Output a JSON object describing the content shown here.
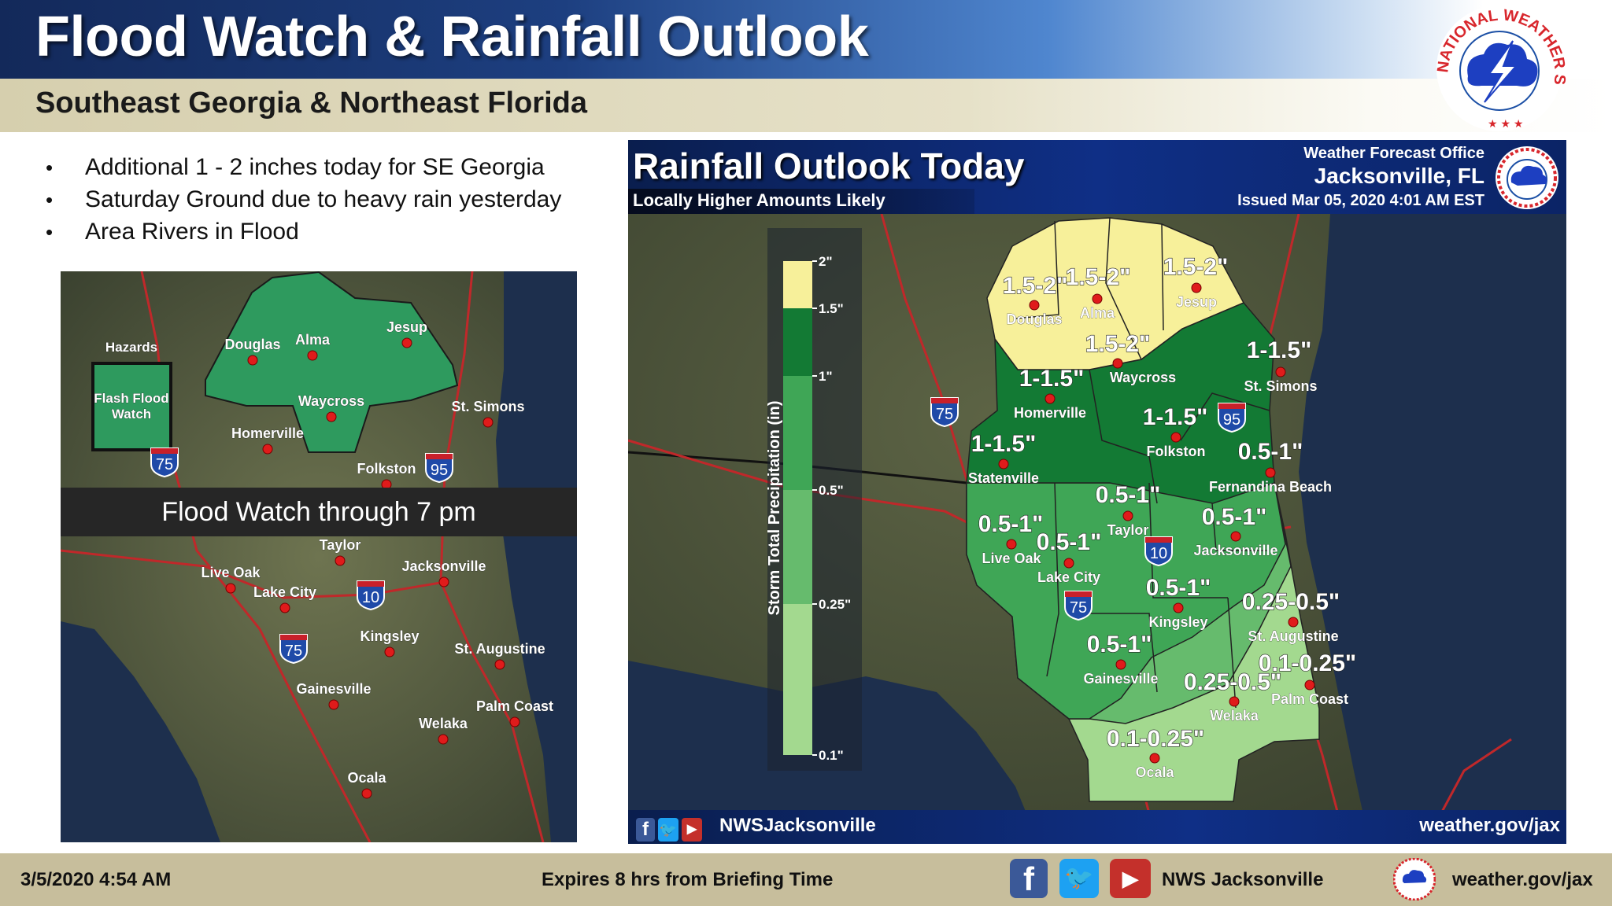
{
  "header": {
    "title": "Flood Watch & Rainfall Outlook",
    "subtitle": "Southeast Georgia & Northeast Florida"
  },
  "logo": {
    "text": "NATIONAL WEATHER SERVICE"
  },
  "bullets": [
    "Additional 1 - 2 inches today for SE Georgia",
    "Saturday Ground due to heavy rain yesterday",
    "Area Rivers in Flood"
  ],
  "hazard_map": {
    "legend_title": "Hazards",
    "legend_item": "Flash Flood Watch",
    "legend_color": "#2e9a5e",
    "banner": "Flood Watch through 7 pm",
    "cities": [
      "Douglas",
      "Alma",
      "Jesup",
      "Waycross",
      "Homerville",
      "St. Simons",
      "Folkston",
      "Taylor",
      "Live Oak",
      "Jacksonville",
      "Lake City",
      "Kingsley",
      "St. Augustine",
      "Gainesville",
      "Palm Coast",
      "Welaka",
      "Ocala"
    ],
    "shields": [
      "75",
      "95",
      "10",
      "75"
    ]
  },
  "rain_map": {
    "title": "Rainfall Outlook Today",
    "subtitle": "Locally Higher Amounts Likely",
    "office_line1": "Weather Forecast Office",
    "office_line2": "Jacksonville, FL",
    "issued": "Issued Mar 05, 2020 4:01 AM EST",
    "footer_handle": "NWSJacksonville",
    "footer_url": "weather.gov/jax",
    "legend_title": "Storm Total Precipitation (in)",
    "legend_ticks": [
      "2\"",
      "1.5\"",
      "1\"",
      "0.5\"",
      "0.25\"",
      "0.1\""
    ],
    "legend_colors": {
      "1.5-2": "#f7f09a",
      "1-1.5": "#137a34",
      "0.5-1": "#3fa656",
      "0.25-0.5": "#66bb6d",
      "0.1-0.25": "#a3d98f"
    },
    "cities": [
      "Douglas",
      "Alma",
      "Jesup",
      "Waycross",
      "Homerville",
      "St. Simons",
      "Folkston",
      "Statenville",
      "Fernandina Beach",
      "Taylor",
      "Live Oak",
      "Jacksonville",
      "Lake City",
      "Kingsley",
      "St. Augustine",
      "Gainesville",
      "Palm Coast",
      "Welaka",
      "Ocala"
    ],
    "amounts": [
      "1.5-2\"",
      "1.5-2\"",
      "1.5-2\"",
      "1.5-2\"",
      "1-1.5\"",
      "1-1.5\"",
      "1-1.5\"",
      "1-1.5\"",
      "0.5-1\"",
      "0.5-1\"",
      "0.5-1\"",
      "0.5-1\"",
      "0.5-1\"",
      "0.5-1\"",
      "0.5-1\"",
      "0.25-0.5\"",
      "0.25-0.5\"",
      "0.1-0.25\"",
      "0.1-0.25\""
    ],
    "shields": [
      "75",
      "95",
      "10",
      "75"
    ]
  },
  "footer": {
    "datetime": "3/5/2020 4:54 AM",
    "expires": "Expires 8 hrs from Briefing Time",
    "social_name": "NWS Jacksonville",
    "url": "weather.gov/jax",
    "social_icons": [
      "facebook-icon",
      "twitter-icon",
      "youtube-icon"
    ]
  }
}
